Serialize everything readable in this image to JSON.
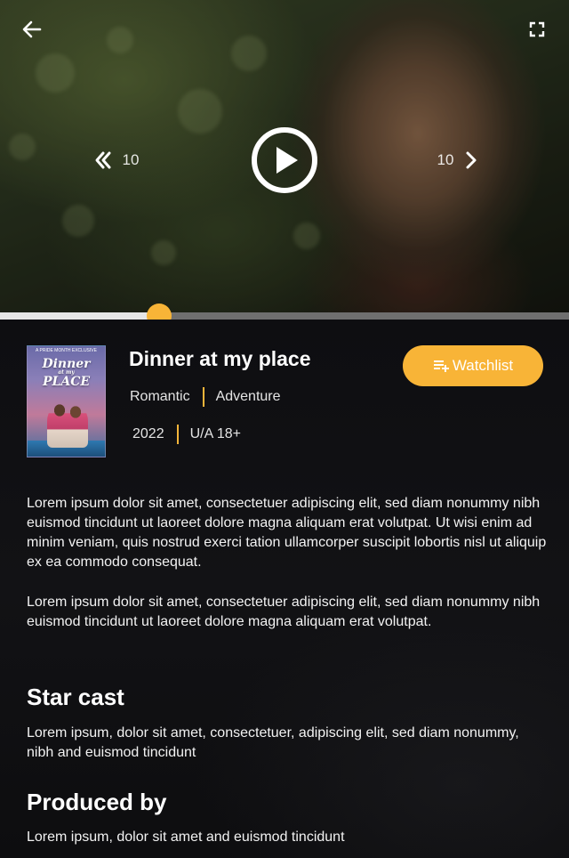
{
  "player": {
    "rewind_seconds": "10",
    "forward_seconds": "10",
    "progress": 0.28
  },
  "movie": {
    "title": "Dinner at my place",
    "genres": [
      "Romantic",
      "Adventure"
    ],
    "year": "2022",
    "rating": "U/A 18+",
    "watchlist_label": "Watchlist",
    "poster": {
      "top_text": "A PRIDE MONTH EXCLUSIVE",
      "title_line1": "Dinner",
      "title_line2": "at my",
      "title_line3": "PLACE"
    },
    "description": [
      "Lorem ipsum dolor sit amet, consectetuer adipiscing elit, sed diam nonummy nibh euismod tincidunt ut laoreet dolore magna aliquam erat volutpat. Ut wisi enim ad minim veniam, quis nostrud exerci tation ullamcorper suscipit lobortis nisl ut aliquip ex ea commodo consequat.",
      "Lorem ipsum dolor sit amet, consectetuer adipiscing elit, sed diam nonummy nibh euismod tincidunt ut laoreet dolore magna aliquam erat volutpat."
    ],
    "star_cast_heading": "Star cast",
    "star_cast": "Lorem ipsum, dolor sit amet, consectetuer, adipiscing elit, sed diam nonummy, nibh and euismod tincidunt",
    "produced_by_heading": "Produced by",
    "produced_by": "Lorem ipsum, dolor sit amet and euismod tincidunt"
  },
  "colors": {
    "accent": "#f8b437",
    "background": "#0c0c0e",
    "text": "#ffffff"
  },
  "icons": {
    "back": "arrow-left-icon",
    "fullscreen": "fullscreen-icon",
    "play": "play-icon",
    "rewind": "chevron-left-double-icon",
    "forward": "chevron-right-icon",
    "watchlist": "playlist-add-icon"
  }
}
